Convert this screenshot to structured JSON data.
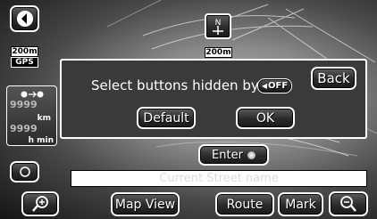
{
  "map": {
    "scale_left": "200m",
    "scale_right": "200m",
    "gps_label": "GPS"
  },
  "info": {
    "distance_value": "9999",
    "distance_unit": "km",
    "time_value": "9999",
    "time_unit": "h min"
  },
  "dialog": {
    "message": "Select buttons hidden by",
    "off_label": "OFF",
    "back_label": "Back",
    "default_label": "Default",
    "ok_label": "OK"
  },
  "enter_label": "Enter",
  "street_placeholder": "Current Street name",
  "toolbar": {
    "map_view_label": "Map View",
    "route_label": "Route",
    "mark_label": "Mark"
  },
  "colors": {
    "button_border": "#ffffff",
    "button_fill": "#2a2a2a",
    "dialog_fill": "#3a3a3a"
  }
}
